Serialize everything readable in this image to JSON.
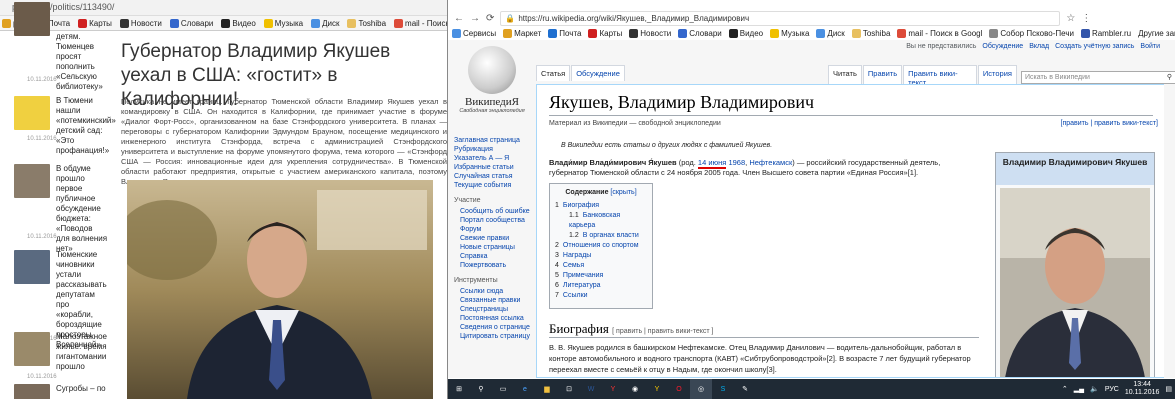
{
  "left": {
    "url": "park72.ru/politics/113490/",
    "bookmarks": [
      {
        "label": "ркет",
        "color": "#e0a020"
      },
      {
        "label": "Почта",
        "color": "#1e6fd0"
      },
      {
        "label": "Карты",
        "color": "#d02020"
      },
      {
        "label": "Новости",
        "color": "#333333"
      },
      {
        "label": "Словари",
        "color": "#3366cc"
      },
      {
        "label": "Видео",
        "color": "#222222"
      },
      {
        "label": "Музыка",
        "color": "#f0c000"
      },
      {
        "label": "Диск",
        "color": "#4a90e2"
      },
      {
        "label": "Toshiba",
        "color": "#e8c060"
      },
      {
        "label": "mail - Поиск в Google",
        "color": "#dd4b39"
      }
    ],
    "feed": [
      {
        "title": "детям. Тюменцев просят пополнить «Сельскую библиотеку»",
        "date": "10.11.2016"
      },
      {
        "title": "В Тюмени нашли «потемкинский» детский сад: «Это профанация!»",
        "date": "10.11.2016"
      },
      {
        "title": "В обдуме прошло первое публичное обсуждение бюджета: «Поводов для волнения нет»",
        "date": "10.11.2016"
      },
      {
        "title": "Тюменские чиновники устали рассказывать депутатам про «корабли, бороздящие просторы Вселенной»",
        "date": "10.11.2016"
      },
      {
        "title": "Малоэтажное жилье: время гигантомании прошло",
        "date": "10.11.2016"
      },
      {
        "title": "Сугробы – по",
        "date": ""
      }
    ],
    "article_title": "Губернатор Владимир Якушев уехал в США: «гостит» в Калифорнии!",
    "article_body": "Политика не имеет границ. Губернатор Тюменской области Владимир Якушев уехал в командировку в США. Он находится в Калифорнии, где принимает участие в форуме «Диалог Форт-Росс», организованном на базе Стэнфордского университета. В планах — переговоры с губернатором Калифорнии Эдмундом Брауном, посещение медицинского и инженерного института Стэнфорда, встреча с администрацией Стэнфордского университета и выступление на форуме упомянутого форума, тема которого — «Стэнфорд США — Россия: инновационные идеи для укрепления сотрудничества». В Тюменской области работают предприятия, открытые с участием американского капитала, поэтому Владимиру Якушеву есть, что рассказать."
  },
  "right": {
    "url": "https://ru.wikipedia.org/wiki/Якушев,_Владимир_Владимирович",
    "bookmarks": [
      {
        "label": "Сервисы",
        "color": "#4a90e2"
      },
      {
        "label": "Маркет",
        "color": "#e0a020"
      },
      {
        "label": "Почта",
        "color": "#1e6fd0"
      },
      {
        "label": "Карты",
        "color": "#d02020"
      },
      {
        "label": "Новости",
        "color": "#333333"
      },
      {
        "label": "Словари",
        "color": "#3366cc"
      },
      {
        "label": "Видео",
        "color": "#222222"
      },
      {
        "label": "Музыка",
        "color": "#f0c000"
      },
      {
        "label": "Диск",
        "color": "#4a90e2"
      },
      {
        "label": "Toshiba",
        "color": "#e8c060"
      },
      {
        "label": "mail - Поиск в Googl",
        "color": "#dd4b39"
      },
      {
        "label": "Собор Псково-Печи",
        "color": "#888888"
      },
      {
        "label": "Rambler.ru",
        "color": "#3355aa"
      }
    ],
    "other_bookmarks": "Другие закладки",
    "wiki": {
      "logo_name": "ВикипедиЯ",
      "logo_slogan": "Свободная энциклопедия",
      "personal": [
        "Вы не представились",
        "Обсуждение",
        "Вклад",
        "Создать учётную запись",
        "Войти"
      ],
      "tabs_left": [
        "Статья",
        "Обсуждение"
      ],
      "tabs_right": [
        "Читать",
        "Править",
        "Править вики-текст",
        "История"
      ],
      "search_placeholder": "Искать в Википедии",
      "nav_main": [
        "Заглавная страница",
        "Рубрикация",
        "Указатель А — Я",
        "Избранные статьи",
        "Случайная статья",
        "Текущие события"
      ],
      "nav_participation_header": "Участие",
      "nav_participation": [
        "Сообщить об ошибке",
        "Портал сообщества",
        "Форум",
        "Свежие правки",
        "Новые страницы",
        "Справка",
        "Пожертвовать"
      ],
      "nav_tools_header": "Инструменты",
      "nav_tools": [
        "Ссылки сюда",
        "Связанные правки",
        "Спецстраницы",
        "Постоянная ссылка",
        "Сведения о странице",
        "Цитировать страницу"
      ],
      "title": "Якушев, Владимир Владимирович",
      "from": "Материал из Википедии — свободной энциклопедии",
      "edit_links": "[править | править вики-текст]",
      "hatnote": "В Википедии есть статьи о других людях с фамилией Якушев.",
      "lead_name": "Влади́мир Влади́мирович Я́кушев",
      "lead_born_prefix": "(род. ",
      "lead_born_date": "14 июня",
      "lead_born_year": "1968",
      "lead_born_place": "Нефтекамск",
      "lead_rest": ") — российский государственный деятель, губернатор Тюменской области с 24 ноября 2005 года. Член Высшего совета партии «Единая Россия»[1].",
      "toc_title": "Содержание",
      "toc_hide": "[скрыть]",
      "toc": [
        {
          "n": "1",
          "t": "Биография",
          "indent": 0
        },
        {
          "n": "1.1",
          "t": "Банковская карьера",
          "indent": 1
        },
        {
          "n": "1.2",
          "t": "В органах власти",
          "indent": 1
        },
        {
          "n": "2",
          "t": "Отношения со спортом",
          "indent": 0
        },
        {
          "n": "3",
          "t": "Награды",
          "indent": 0
        },
        {
          "n": "4",
          "t": "Семья",
          "indent": 0
        },
        {
          "n": "5",
          "t": "Примечания",
          "indent": 0
        },
        {
          "n": "6",
          "t": "Литература",
          "indent": 0
        },
        {
          "n": "7",
          "t": "Ссылки",
          "indent": 0
        }
      ],
      "bio_heading": "Биография",
      "bio_edit": "[ править | править вики-текст ]",
      "bio_text": "В. В. Якушев родился в башкирском Нефтекамске. Отец Владимир Данилович — водитель-дальнобойщик, работал в конторе автомобильного и водного транспорта (КАВТ) «Сибтрубопроводстрой»[2]. В возрасте 7 лет будущий губернатор переехал вместе с семьёй к отцу в Надым, где окончил школу[3].",
      "infobox_title": "Владимир Владимирович Якушев"
    },
    "taskbar": {
      "lang": "РУС",
      "time": "13:44",
      "date": "10.11.2016"
    }
  }
}
